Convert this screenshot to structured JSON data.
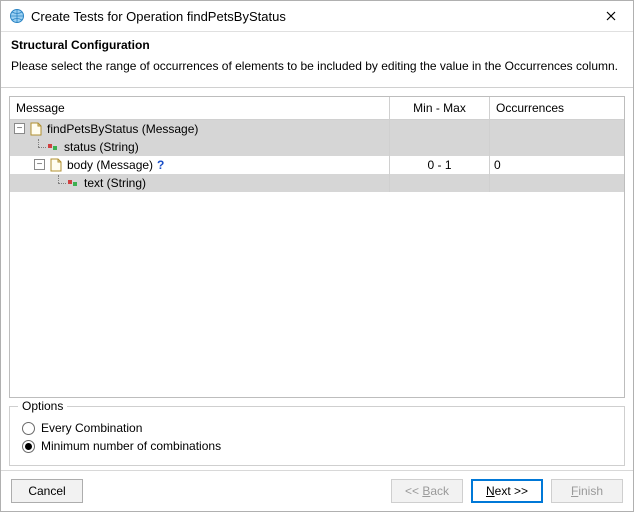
{
  "window": {
    "title": "Create Tests for Operation findPetsByStatus"
  },
  "header": {
    "heading": "Structural Configuration",
    "subtext": "Please select the range of occurrences of elements to be included by editing the value in the Occurrences column."
  },
  "table": {
    "columns": {
      "message": "Message",
      "minmax": "Min - Max",
      "occurrences": "Occurrences"
    },
    "rows": [
      {
        "label": "findPetsByStatus (Message)",
        "minmax": "",
        "occ": ""
      },
      {
        "label": "status (String)",
        "minmax": "",
        "occ": ""
      },
      {
        "label": "body (Message)",
        "opt": "?",
        "minmax": "0 - 1",
        "occ": "0"
      },
      {
        "label": "text (String)",
        "minmax": "",
        "occ": ""
      }
    ]
  },
  "options": {
    "legend": "Options",
    "every": "Every Combination",
    "min": "Minimum number of combinations"
  },
  "buttons": {
    "cancel": "Cancel",
    "back_pre": "<< ",
    "back_mn": "B",
    "back_post": "ack",
    "next_mn": "N",
    "next_post": "ext >>",
    "finish_mn": "F",
    "finish_post": "inish"
  }
}
